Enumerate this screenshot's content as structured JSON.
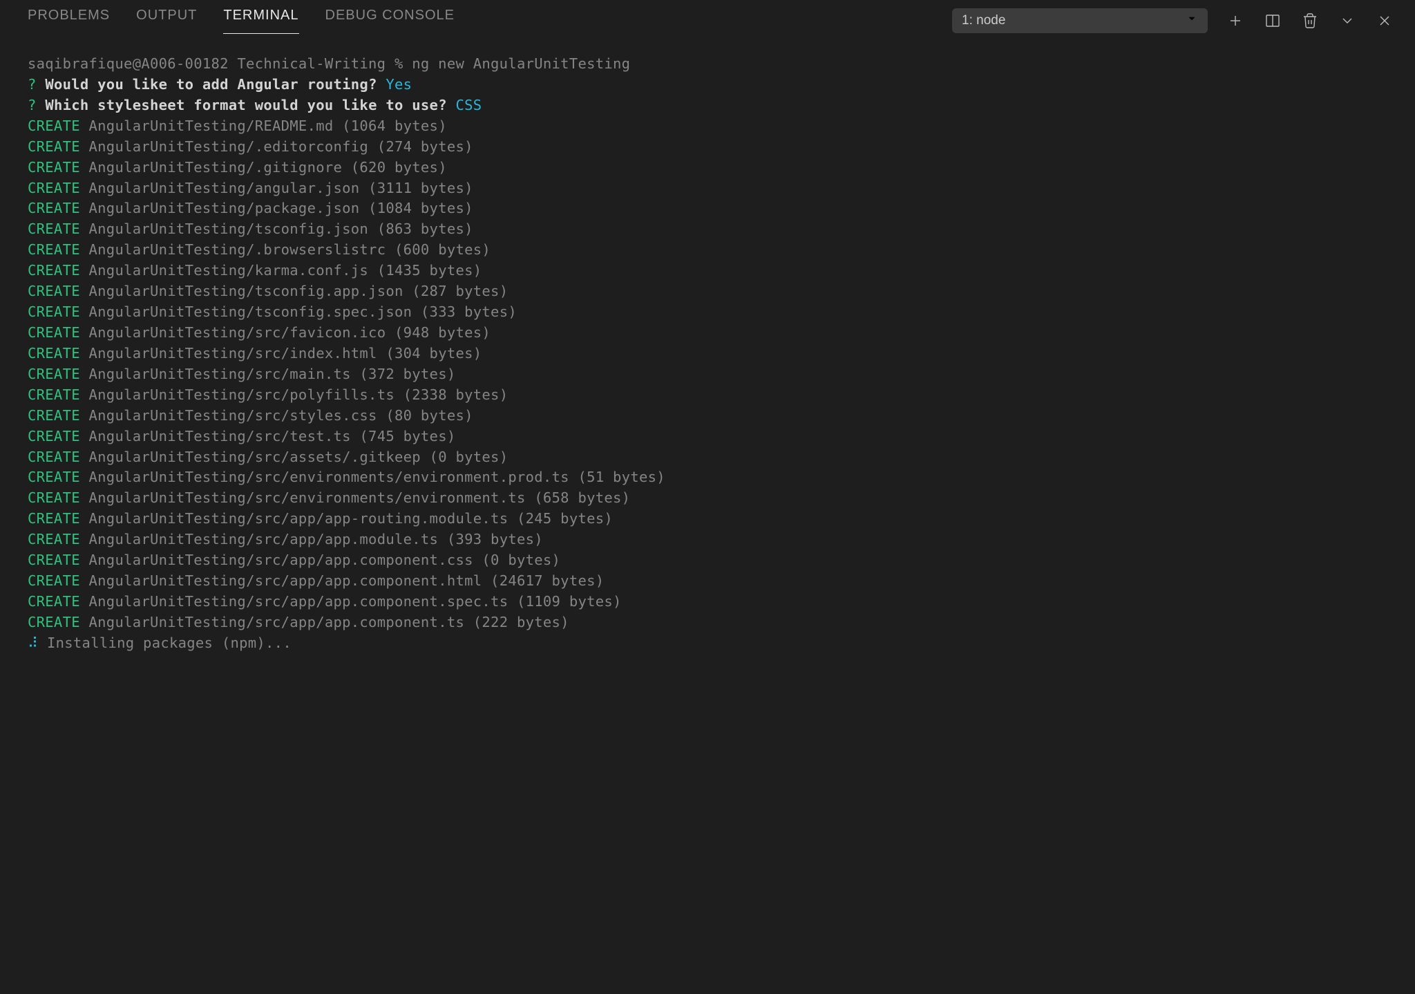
{
  "tabs": {
    "problems": "PROBLEMS",
    "output": "OUTPUT",
    "terminal": "TERMINAL",
    "debug_console": "DEBUG CONSOLE"
  },
  "terminal_select": {
    "label": "1: node"
  },
  "prompt_line": "saqibrafique@A006-00182 Technical-Writing % ng new AngularUnitTesting",
  "questions": [
    {
      "q": "Would you like to add Angular routing?",
      "a": "Yes"
    },
    {
      "q": "Which stylesheet format would you like to use?",
      "a": "CSS"
    }
  ],
  "creates": [
    "AngularUnitTesting/README.md (1064 bytes)",
    "AngularUnitTesting/.editorconfig (274 bytes)",
    "AngularUnitTesting/.gitignore (620 bytes)",
    "AngularUnitTesting/angular.json (3111 bytes)",
    "AngularUnitTesting/package.json (1084 bytes)",
    "AngularUnitTesting/tsconfig.json (863 bytes)",
    "AngularUnitTesting/.browserslistrc (600 bytes)",
    "AngularUnitTesting/karma.conf.js (1435 bytes)",
    "AngularUnitTesting/tsconfig.app.json (287 bytes)",
    "AngularUnitTesting/tsconfig.spec.json (333 bytes)",
    "AngularUnitTesting/src/favicon.ico (948 bytes)",
    "AngularUnitTesting/src/index.html (304 bytes)",
    "AngularUnitTesting/src/main.ts (372 bytes)",
    "AngularUnitTesting/src/polyfills.ts (2338 bytes)",
    "AngularUnitTesting/src/styles.css (80 bytes)",
    "AngularUnitTesting/src/test.ts (745 bytes)",
    "AngularUnitTesting/src/assets/.gitkeep (0 bytes)",
    "AngularUnitTesting/src/environments/environment.prod.ts (51 bytes)",
    "AngularUnitTesting/src/environments/environment.ts (658 bytes)",
    "AngularUnitTesting/src/app/app-routing.module.ts (245 bytes)",
    "AngularUnitTesting/src/app/app.module.ts (393 bytes)",
    "AngularUnitTesting/src/app/app.component.css (0 bytes)",
    "AngularUnitTesting/src/app/app.component.html (24617 bytes)",
    "AngularUnitTesting/src/app/app.component.spec.ts (1109 bytes)",
    "AngularUnitTesting/src/app/app.component.ts (222 bytes)"
  ],
  "create_label": "CREATE",
  "question_marker": "?",
  "spinner": "⠼",
  "installing": "Installing packages (npm)..."
}
